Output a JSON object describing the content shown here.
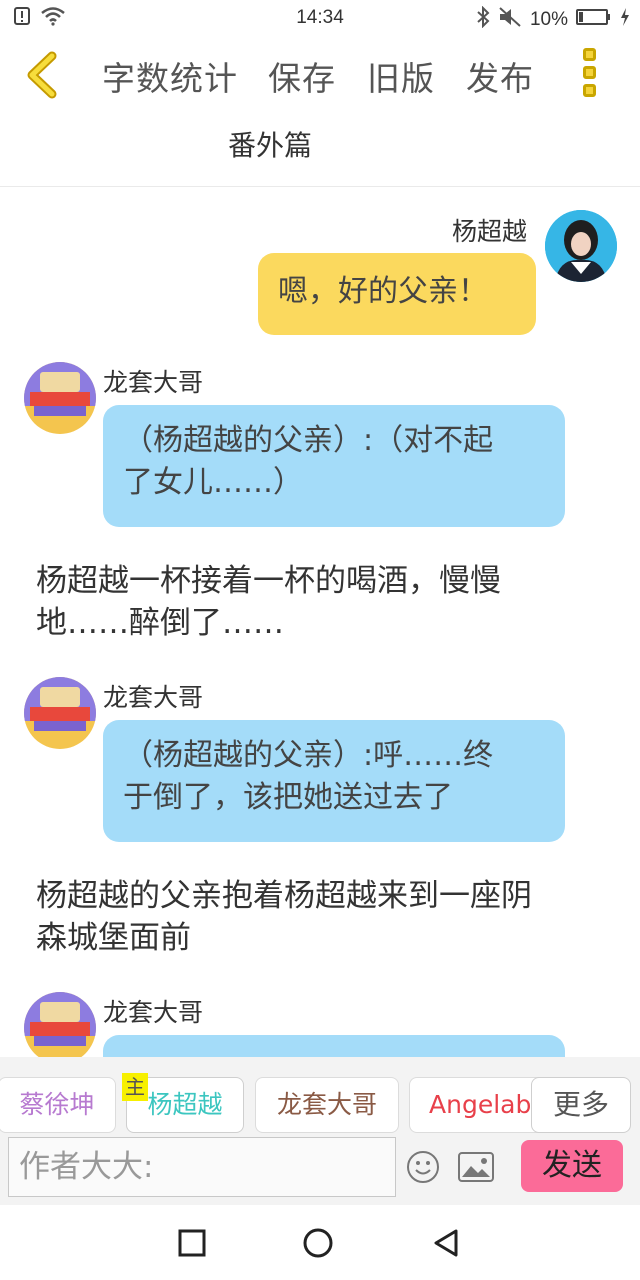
{
  "status_bar": {
    "time": "14:34",
    "battery": "10%"
  },
  "toolbar": {
    "word_count": "字数统计",
    "save": "保存",
    "old_version": "旧版",
    "publish": "发布"
  },
  "chapter": {
    "title": "番外篇"
  },
  "messages": [
    {
      "sender": "杨超越",
      "text": "嗯，好的父亲！"
    },
    {
      "sender": "龙套大哥",
      "text_line1": "（杨超越的父亲）:（对不起",
      "text_line2": "了女儿……）"
    },
    {
      "narration_line1": "杨超越一杯接着一杯的喝酒，慢慢",
      "narration_line2": "地……醉倒了……"
    },
    {
      "sender": "龙套大哥",
      "text_line1": "（杨超越的父亲）:呼……终",
      "text_line2": "于倒了，该把她送过去了"
    },
    {
      "narration_line1": "杨超越的父亲抱着杨超越来到一座阴",
      "narration_line2": "森城堡面前"
    },
    {
      "sender": "龙套大哥"
    }
  ],
  "characters": {
    "items": [
      "蔡徐坤",
      "杨超越",
      "龙套大哥",
      "Angelaba"
    ],
    "host_badge": "主",
    "more": "更多"
  },
  "input": {
    "placeholder": "作者大大:"
  },
  "send_label": "发送",
  "colors": {
    "self_bubble": "#fbd95e",
    "other_bubble": "#a4dcf9",
    "send_button": "#fb6b98",
    "accent": "#f5d43a"
  }
}
